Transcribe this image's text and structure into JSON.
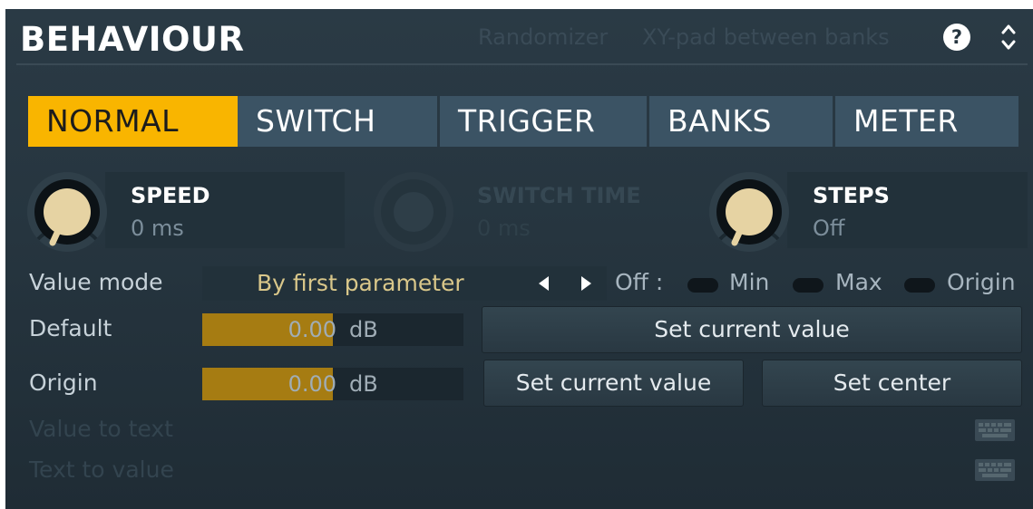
{
  "header": {
    "title": "BEHAVIOUR",
    "links": [
      "Randomizer",
      "XY-pad between banks"
    ],
    "help_label": "?"
  },
  "tabs": [
    {
      "label": "NORMAL",
      "active": true
    },
    {
      "label": "SWITCH",
      "active": false
    },
    {
      "label": "TRIGGER",
      "active": false
    },
    {
      "label": "BANKS",
      "active": false
    },
    {
      "label": "METER",
      "active": false
    }
  ],
  "knobs": [
    {
      "label": "SPEED",
      "value": "0 ms",
      "enabled": true
    },
    {
      "label": "SWITCH TIME",
      "value": "0 ms",
      "enabled": false
    },
    {
      "label": "STEPS",
      "value": "Off",
      "enabled": true
    }
  ],
  "value_mode": {
    "label": "Value mode",
    "selected": "By first parameter",
    "off_label": "Off :",
    "toggles": [
      {
        "label": "Min",
        "on": false
      },
      {
        "label": "Max",
        "on": false
      },
      {
        "label": "Origin",
        "on": false
      }
    ]
  },
  "default_row": {
    "label": "Default",
    "value": "0.00",
    "unit": "dB",
    "fill_fraction": 0.5,
    "button": "Set current value"
  },
  "origin_row": {
    "label": "Origin",
    "value": "0.00",
    "unit": "dB",
    "fill_fraction": 0.5,
    "buttons": [
      "Set current value",
      "Set center"
    ]
  },
  "value_to_text": {
    "label": "Value to text",
    "enabled": false
  },
  "text_to_value": {
    "label": "Text to value",
    "enabled": false
  },
  "colors": {
    "accent": "#f9b500",
    "tab": "#3b5364",
    "panel": "#26353f",
    "knob": "#e6d3a3",
    "slider_fill": "#a67c12"
  }
}
